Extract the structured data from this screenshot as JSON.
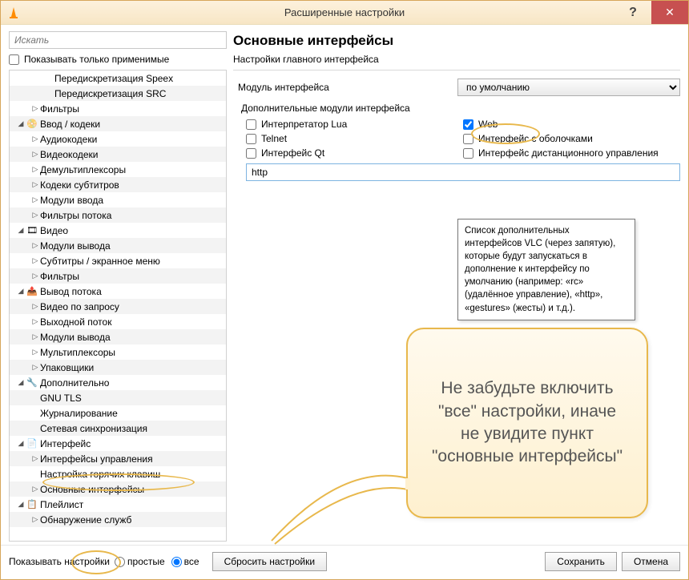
{
  "window": {
    "title": "Расширенные настройки"
  },
  "left": {
    "search_placeholder": "Искать",
    "only_applicable": "Показывать только применимые",
    "tree": [
      {
        "depth": 2,
        "exp": "",
        "label": "Передискретизация Speex"
      },
      {
        "depth": 2,
        "exp": "",
        "label": "Передискретизация SRC"
      },
      {
        "depth": 1,
        "exp": "▷",
        "label": "Фильтры"
      },
      {
        "depth": 0,
        "exp": "◢",
        "icon": "input",
        "label": "Ввод / кодеки"
      },
      {
        "depth": 1,
        "exp": "▷",
        "label": "Аудиокодеки"
      },
      {
        "depth": 1,
        "exp": "▷",
        "label": "Видеокодеки"
      },
      {
        "depth": 1,
        "exp": "▷",
        "label": "Демультиплексоры"
      },
      {
        "depth": 1,
        "exp": "▷",
        "label": "Кодеки субтитров"
      },
      {
        "depth": 1,
        "exp": "▷",
        "label": "Модули ввода"
      },
      {
        "depth": 1,
        "exp": "▷",
        "label": "Фильтры потока"
      },
      {
        "depth": 0,
        "exp": "◢",
        "icon": "video",
        "label": "Видео"
      },
      {
        "depth": 1,
        "exp": "▷",
        "label": "Модули вывода"
      },
      {
        "depth": 1,
        "exp": "▷",
        "label": "Субтитры / экранное меню"
      },
      {
        "depth": 1,
        "exp": "▷",
        "label": "Фильтры"
      },
      {
        "depth": 0,
        "exp": "◢",
        "icon": "stream",
        "label": "Вывод потока"
      },
      {
        "depth": 1,
        "exp": "▷",
        "label": "Видео по запросу"
      },
      {
        "depth": 1,
        "exp": "▷",
        "label": "Выходной поток"
      },
      {
        "depth": 1,
        "exp": "▷",
        "label": "Модули вывода"
      },
      {
        "depth": 1,
        "exp": "▷",
        "label": "Мультиплексоры"
      },
      {
        "depth": 1,
        "exp": "▷",
        "label": "Упаковщики"
      },
      {
        "depth": 0,
        "exp": "◢",
        "icon": "advanced",
        "label": "Дополнительно"
      },
      {
        "depth": 1,
        "exp": "",
        "label": "GNU TLS"
      },
      {
        "depth": 1,
        "exp": "",
        "label": "Журналирование"
      },
      {
        "depth": 1,
        "exp": "",
        "label": "Сетевая синхронизация"
      },
      {
        "depth": 0,
        "exp": "◢",
        "icon": "interface",
        "label": "Интерфейс"
      },
      {
        "depth": 1,
        "exp": "▷",
        "label": "Интерфейсы управления"
      },
      {
        "depth": 1,
        "exp": "",
        "label": "Настройка горячих клавиш"
      },
      {
        "depth": 1,
        "exp": "▷",
        "label": "Основные интерфейсы"
      },
      {
        "depth": 0,
        "exp": "◢",
        "icon": "playlist",
        "label": "Плейлист"
      },
      {
        "depth": 1,
        "exp": "▷",
        "label": "Обнаружение служб"
      }
    ]
  },
  "right": {
    "heading": "Основные интерфейсы",
    "subtitle": "Настройки главного интерфейса",
    "module_label": "Модуль интерфейса",
    "module_value": "по умолчанию",
    "extra_modules_label": "Дополнительные модули интерфейса",
    "checks": {
      "lua": "Интерпретатор Lua",
      "web": "Web",
      "telnet": "Telnet",
      "skins": "Интерфейс с оболочками",
      "qt": "Интерфейс Qt",
      "remote": "Интерфейс дистанционного управления"
    },
    "http_value": "http",
    "tooltip": "Список дополнительных интерфейсов VLC (через запятую), которые будут запускаться в дополнение к интерфейсу по умолчанию (например: «rc» (удалённое управление), «http», «gestures» (жесты) и т.д.).",
    "callout": "Не забудьте включить \"все\" настройки, иначе не увидите пункт \"основные интерфейсы\""
  },
  "footer": {
    "show_label": "Показывать настройки",
    "simple": "простые",
    "all": "все",
    "reset": "Сбросить настройки",
    "save": "Сохранить",
    "cancel": "Отмена"
  }
}
